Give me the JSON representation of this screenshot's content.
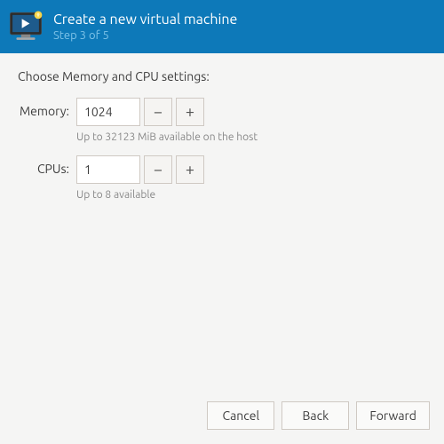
{
  "header": {
    "title": "Create a new virtual machine",
    "subtitle": "Step 3 of 5"
  },
  "instruction": "Choose Memory and CPU settings:",
  "memory": {
    "label": "Memory:",
    "value": "1024",
    "hint": "Up to 32123 MiB available on the host"
  },
  "cpus": {
    "label": "CPUs:",
    "value": "1",
    "hint": "Up to 8 available"
  },
  "buttons": {
    "cancel": "Cancel",
    "back": "Back",
    "forward": "Forward"
  },
  "glyphs": {
    "minus": "−",
    "plus": "+"
  }
}
